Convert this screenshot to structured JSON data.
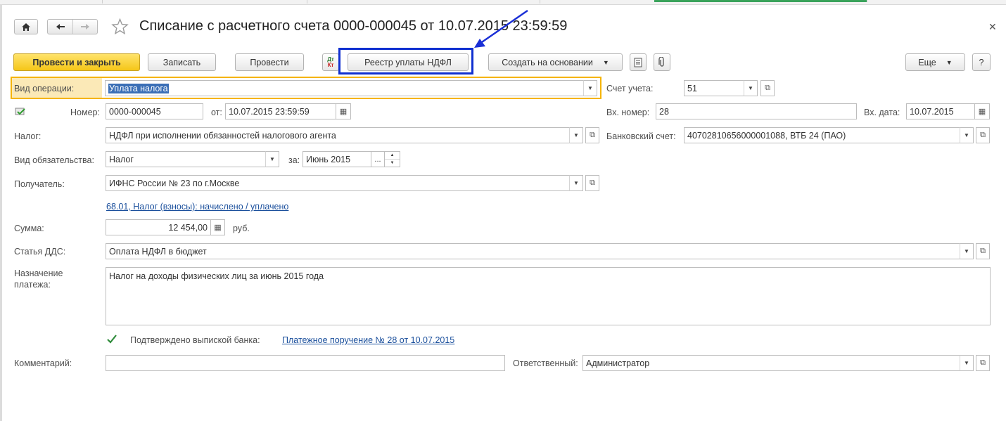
{
  "window": {
    "title": "Списание с расчетного счета 0000-000045 от 10.07.2015 23:59:59"
  },
  "toolbar": {
    "post_close": "Провести и закрыть",
    "save": "Записать",
    "post": "Провести",
    "registry": "Реестр уплаты НДФЛ",
    "create_based": "Создать на основании",
    "more": "Еще",
    "help": "?",
    "dtkt_top": "Дт",
    "dtkt_bottom": "Кт"
  },
  "form": {
    "operation_type": {
      "label": "Вид операции:",
      "value": "Уплата налога"
    },
    "account": {
      "label": "Счет учета:",
      "value": "51"
    },
    "number": {
      "label": "Номер:",
      "value": "0000-000045"
    },
    "date": {
      "label": "от:",
      "value": "10.07.2015 23:59:59"
    },
    "in_number": {
      "label": "Вх. номер:",
      "value": "28"
    },
    "in_date": {
      "label": "Вх. дата:",
      "value": "10.07.2015"
    },
    "tax": {
      "label": "Налог:",
      "value": "НДФЛ при исполнении обязанностей налогового агента"
    },
    "bank_account": {
      "label": "Банковский счет:",
      "value": "40702810656000001088, ВТБ 24 (ПАО)"
    },
    "obligation": {
      "label": "Вид обязательства:",
      "value": "Налог"
    },
    "period": {
      "label": "за:",
      "value": "Июнь 2015",
      "dots": "..."
    },
    "recipient": {
      "label": "Получатель:",
      "value": "ИФНС России № 23 по г.Москве"
    },
    "tax_link": "68.01, Налог (взносы): начислено / уплачено",
    "amount": {
      "label": "Сумма:",
      "value": "12 454,00",
      "currency": "руб."
    },
    "cash_flow": {
      "label": "Статья ДДС:",
      "value": "Оплата НДФЛ в бюджет"
    },
    "purpose": {
      "label_line1": "Назначение",
      "label_line2": "платежа:",
      "value": "Налог на доходы физических лиц за июнь 2015 года"
    },
    "confirmed": {
      "label": "Подтверждено выпиской банка:",
      "checked": true,
      "link": "Платежное поручение № 28 от 10.07.2015"
    },
    "comment": {
      "label": "Комментарий:",
      "value": ""
    },
    "responsible": {
      "label": "Ответственный:",
      "value": "Администратор"
    }
  },
  "colors": {
    "primary_button": "#f5c618",
    "focus_border": "#f5b400",
    "highlight_box": "#1030d0",
    "arrow": "#1a2fd6",
    "link": "#1a4f9c",
    "label_focus_bg": "#fbe9b7"
  }
}
